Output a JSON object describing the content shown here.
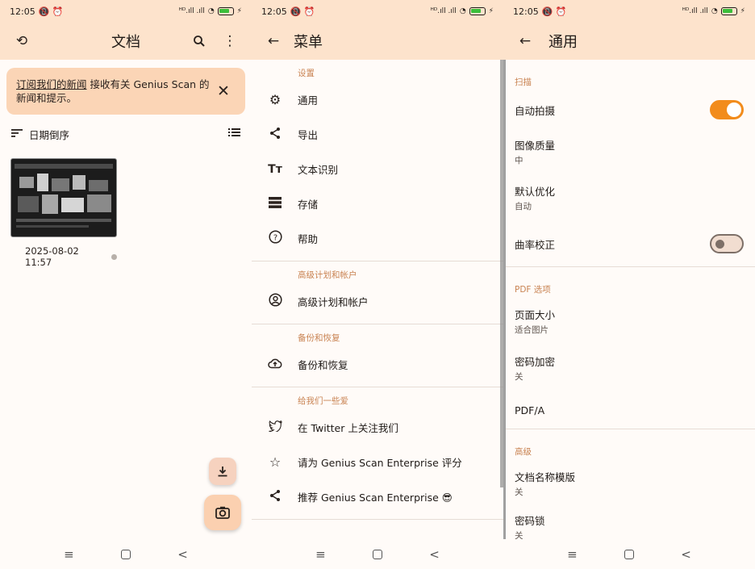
{
  "status": {
    "time": "12:05",
    "icons": "📵 ⏰",
    "signal": "ᴴᴰ.ıll .ıll",
    "wifi": "◠",
    "battery": "⚡"
  },
  "screen1": {
    "title": "文档",
    "banner": {
      "link": "订阅我们的新闻",
      "text": " 接收有关 Genius Scan 的新闻和提示。"
    },
    "sort_label": "日期倒序",
    "doc_date": "2025-08-02 11:57"
  },
  "screen2": {
    "title": "菜单",
    "sections": [
      {
        "head": "设置",
        "items": [
          {
            "icon": "⚙",
            "label": "通用"
          },
          {
            "icon": "<",
            "label": "导出"
          },
          {
            "icon": "Tт",
            "label": "文本识别"
          },
          {
            "icon": "≡",
            "label": "存储"
          },
          {
            "icon": "?",
            "label": "帮助"
          }
        ]
      },
      {
        "head": "高级计划和帐户",
        "items": [
          {
            "icon": "☺",
            "label": "高级计划和帐户"
          }
        ]
      },
      {
        "head": "备份和恢复",
        "items": [
          {
            "icon": "☁",
            "label": "备份和恢复"
          }
        ]
      },
      {
        "head": "给我们一些爱",
        "items": [
          {
            "icon": "🐦",
            "label": "在 Twitter 上关注我们"
          },
          {
            "icon": "☆",
            "label": "请为 Genius Scan Enterprise 评分"
          },
          {
            "icon": "<",
            "label": "推荐 Genius Scan Enterprise 😎"
          }
        ]
      }
    ]
  },
  "screen3": {
    "title": "通用",
    "sec_scan": "扫描",
    "auto_capture": "自动拍摄",
    "image_quality": "图像质量",
    "image_quality_val": "中",
    "default_opt": "默认优化",
    "default_opt_val": "自动",
    "curvature": "曲率校正",
    "sec_pdf": "PDF 选项",
    "page_size": "页面大小",
    "page_size_val": "适合图片",
    "password": "密码加密",
    "password_val": "关",
    "pdfa": "PDF/A",
    "sec_adv": "高级",
    "name_template": "文档名称模版",
    "name_template_val": "关",
    "pin_lock": "密码锁",
    "pin_lock_val": "关",
    "toggle_auto_capture": true,
    "toggle_curvature": false
  },
  "nav": {
    "menu": "≡",
    "back": "<"
  }
}
